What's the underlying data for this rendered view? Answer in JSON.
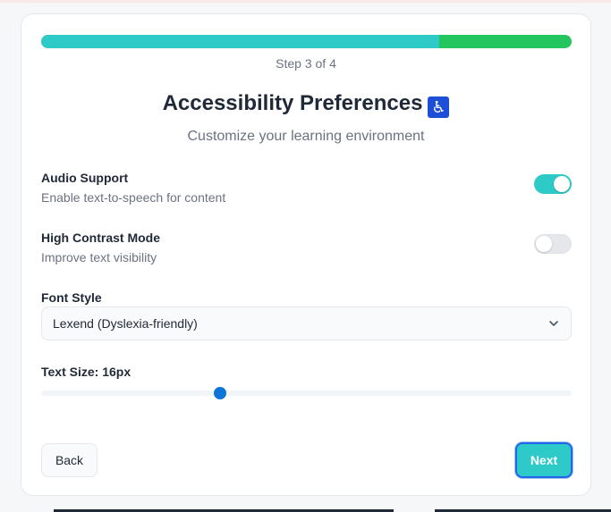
{
  "progress": {
    "step_text": "Step 3 of 4",
    "fraction": 0.75,
    "fill_color": "#2ecac8",
    "track_color": "#22c55e"
  },
  "header": {
    "title": "Accessibility Preferences",
    "title_emoji": "♿",
    "subtitle": "Customize your learning environment"
  },
  "settings": [
    {
      "label": "Audio Support",
      "description": "Enable text-to-speech for content",
      "enabled": true
    },
    {
      "label": "High Contrast Mode",
      "description": "Improve text visibility",
      "enabled": false
    }
  ],
  "font_style": {
    "label": "Font Style",
    "selected": "Lexend (Dyslexia-friendly)",
    "icon": "chevron-down-icon"
  },
  "text_size": {
    "label": "Text Size: 16px",
    "fraction": 0.337,
    "thumb_color": "#0d75d8"
  },
  "actions": {
    "back_label": "Back",
    "next_label": "Next",
    "accent_color": "#2ecac8"
  }
}
